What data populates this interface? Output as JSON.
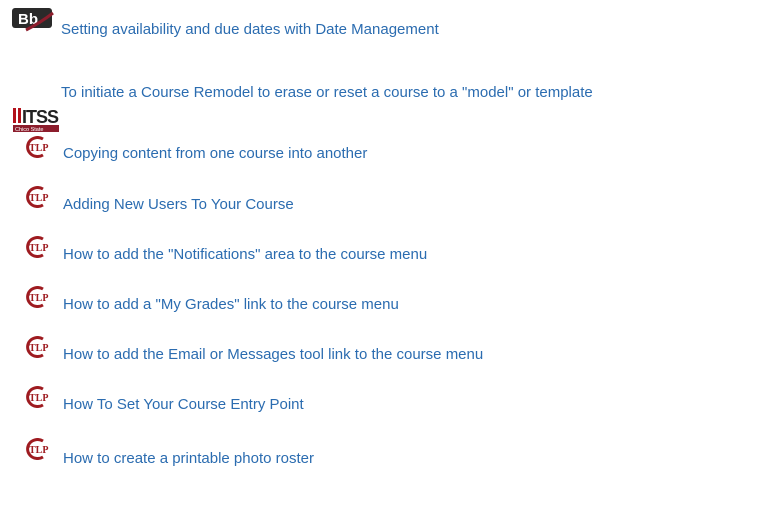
{
  "links": [
    {
      "icon": "bb-icon",
      "label": "Setting availability and due dates with Date Management"
    },
    {
      "icon": "itss-icon",
      "label": "To initiate a Course Remodel to erase or reset a course to a \"model\" or template",
      "icon_text": "ITSS",
      "icon_subtext": "Chico State"
    },
    {
      "icon": "tlp-icon",
      "label": "Copying content from one course into another"
    },
    {
      "icon": "tlp-icon",
      "label": "Adding New Users To Your Course"
    },
    {
      "icon": "tlp-icon",
      "label": "How to add the \"Notifications\" area to the course menu"
    },
    {
      "icon": "tlp-icon",
      "label": "How to add a \"My Grades\" link to the course menu"
    },
    {
      "icon": "tlp-icon",
      "label": "How to add the Email or Messages tool link to the course menu"
    },
    {
      "icon": "tlp-icon",
      "label": "How To Set Your Course Entry Point"
    },
    {
      "icon": "tlp-icon",
      "label": "How to create a printable photo roster"
    }
  ],
  "icons": {
    "bb_text": "Bb",
    "tlp_text": "TLP"
  },
  "colors": {
    "link": "#2b6cb0",
    "bb_bg": "#2a2a2a",
    "bb_swoosh": "#8c1d2c",
    "itss_red": "#b3121b",
    "tlp_red": "#9e1b20"
  }
}
